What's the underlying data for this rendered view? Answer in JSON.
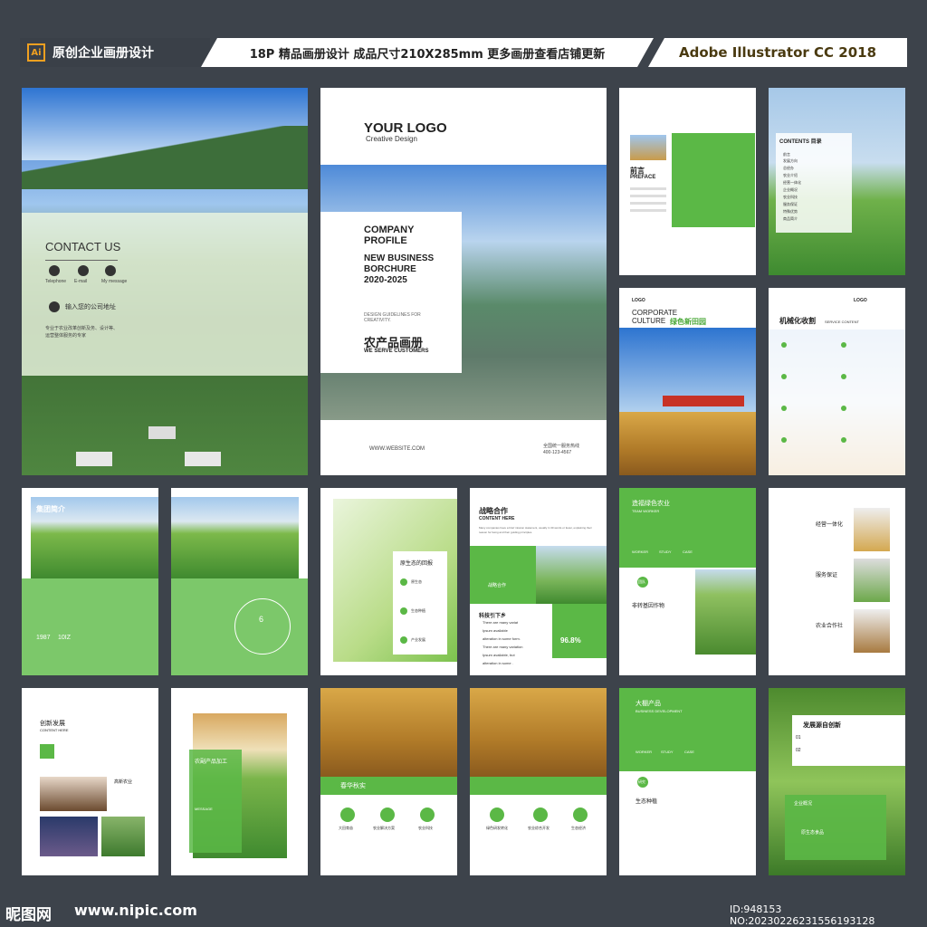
{
  "header": {
    "left": "原创企业画册设计",
    "ai": "Ai",
    "middle": "18P 精品画册设计 成品尺寸210X285mm 更多画册查看店铺更新",
    "right": "Adobe Illustrator CC 2018"
  },
  "contact": {
    "title": "CONTACT US",
    "labels": [
      "Telephone",
      "E-mail",
      "My message"
    ],
    "address": "输入您的公司地址",
    "desc": "专业于农业改革创新及务、设计等、运营整体服务的专家"
  },
  "cover": {
    "logo": "YOUR LOGO",
    "logo_sub": "Creative Design",
    "title1": "COMPANY",
    "title2": "PROFILE",
    "title3": "NEW BUSINESS BORCHURE 2020-2025",
    "guide": "DESIGN GUIDELINES FOR CREATIVITY.",
    "cn": "农产品画册",
    "serve": "WE SERVE CUSTOMERS",
    "website": "WWW.WEBSITE.COM",
    "hotline": "全国统一服务热线",
    "phone": "400-123-4567"
  },
  "preface": {
    "title": "前言",
    "en": "PREFACE"
  },
  "contents": {
    "title": "CONTENTS 目录",
    "items": [
      "前言",
      "发展方向",
      "总经办",
      "农业介绍",
      "经营一体化",
      "企业概况",
      "农业科技",
      "服务保证",
      "特殊优势",
      "商品简介"
    ]
  },
  "culture": {
    "logo": "LOGO",
    "title": "CORPORATE CULTURE",
    "cn": "绿色新田园"
  },
  "machine": {
    "logo": "LOGO",
    "title": "机械化收割",
    "sub": "SERVICE CONTENT"
  },
  "group": {
    "title": "集团简介",
    "y1": "1987",
    "y2": "10IZ"
  },
  "cycle": {
    "num": "6"
  },
  "eco": {
    "title": "原生态的回报",
    "items": [
      "原生态",
      "生态种植",
      "产业发展"
    ]
  },
  "strategy": {
    "title": "战略合作",
    "sub": "CONTENT HERE",
    "desc": "Many companies have a brief mission statement, usually in 30 words or fewer, explaining their reason for being and their guiding principles.",
    "label": "战略合作",
    "tech": "科技引下乡",
    "bullets": [
      "There are many variat",
      "Ipsum available",
      "alteration in some form.",
      "There are many variation",
      "Ipsum available, but",
      "alteration in some ."
    ],
    "pct": "96.8%"
  },
  "team": {
    "title": "造福绿色农业",
    "sub": "TEAM WORKER",
    "tabs": [
      "WORKER",
      "STUDY",
      "CASE"
    ],
    "badge": "团队",
    "label": "非转基因作物"
  },
  "features": {
    "items": [
      "经营一体化",
      "服务保证",
      "农业合作社"
    ]
  },
  "innovate": {
    "title": "创新发展",
    "sub": "CONTENT HERE",
    "label": "高新农业"
  },
  "process": {
    "title": "农副产品加工",
    "msg": "MESSAGE"
  },
  "harvest": {
    "title": "春华秋实",
    "items": [
      "大田育苗",
      "农业解决方案",
      "农业科技"
    ]
  },
  "harvest2": {
    "items": [
      "绿色研发转化",
      "农业综合开发",
      "生态经济"
    ]
  },
  "business": {
    "title": "大棚产品",
    "sub": "BUSINESS DEVELOPMENT",
    "tabs": [
      "WORKER",
      "STUDY",
      "CASE"
    ],
    "badge": "研究",
    "label": "生态种植"
  },
  "source": {
    "title": "发展源自创新",
    "n1": "01",
    "n2": "02",
    "label1": "企业概况",
    "label2": "原生态食品"
  },
  "footer": {
    "brand": "昵图网",
    "site": "www.nipic.com",
    "id": "ID:948153 NO:20230226231556193128"
  },
  "colors": {
    "green": "#5bb846",
    "dark": "#3d434b"
  }
}
